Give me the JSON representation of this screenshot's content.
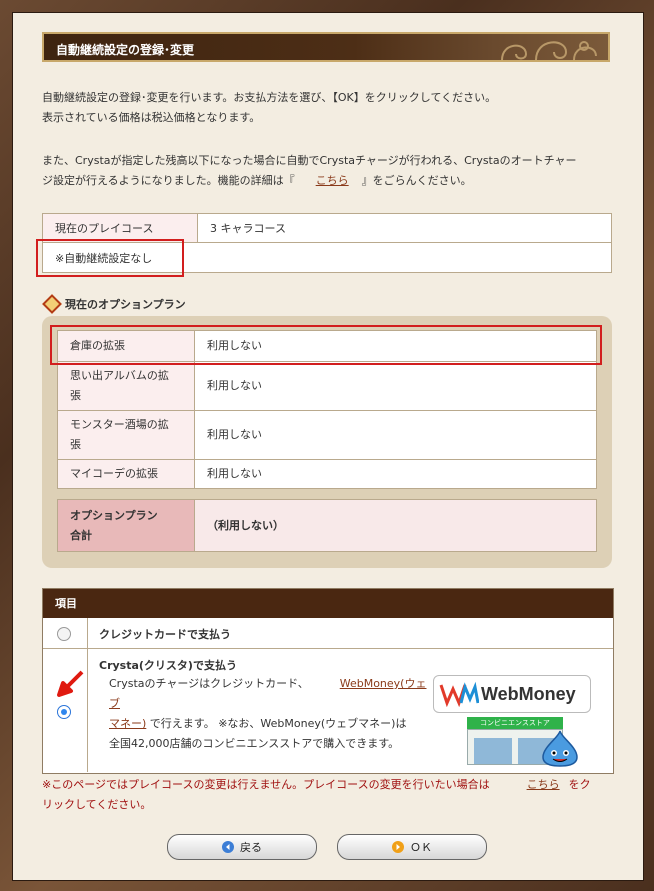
{
  "page": {
    "title": "自動継続設定の登録･変更",
    "intro_lines": [
      "自動継続設定の登録･変更を行います。お支払方法を選び、【OK】をクリックしてください。",
      "表示されている価格は税込価格となります。"
    ],
    "notice_line1": "また、Crystaが指定した残高以下になった場合に自動でCrystaチャージが行われる、Crystaのオートチャー",
    "notice_line2_prefix": "ジ設定が行えるようになりました。機能の詳細は『",
    "notice_link": "こちら",
    "notice_line2_suffix": "』をごらんください。"
  },
  "current": {
    "play_course_label": "現在のプレイコース",
    "play_course_value": "3 キャラコース",
    "auto_renew_note": "※自動継続設定なし"
  },
  "options": {
    "heading": "現在のオプションプラン",
    "rows": [
      {
        "label": "倉庫の拡張",
        "value": "利用しない"
      },
      {
        "label_l1": "思い出アルバムの拡",
        "label_l2": "張",
        "value": "利用しない"
      },
      {
        "label_l1": "モンスター酒場の拡",
        "label_l2": "張",
        "value": "利用しない"
      },
      {
        "label": "マイコーデの拡張",
        "value": "利用しない"
      }
    ],
    "total_label_l1": "オプションプラン",
    "total_label_l2": "合計",
    "total_value": "（利用しない）"
  },
  "payment": {
    "header": "項目",
    "credit_label": "クレジットカードで支払う",
    "crysta_label": "Crysta(クリスタ)で支払う",
    "crysta_desc_1a": "Crystaのチャージはクレジットカード、",
    "crysta_desc_1b": "WebMoney(ウェブ",
    "crysta_desc_2a": "マネー)",
    "crysta_desc_2b": "で行えます。 ※なお、WebMoney(ウェブマネー)は",
    "crysta_desc_3": "全国42,000店舗のコンビニエンスストアで購入できます。",
    "webmoney_brand": "WebMoney",
    "webmoney_store": "コンビニエンスストア",
    "selected": "crysta"
  },
  "warning": {
    "prefix": "※このページではプレイコースの変更は行えません。プレイコースの変更を行いたい場合は",
    "link": "こちら",
    "suffix": "をク",
    "line2": "リックしてください。"
  },
  "buttons": {
    "back_label": "戻る",
    "ok_label": "ＯＫ"
  },
  "colors": {
    "title_bg": "#4d2e16",
    "header_bg": "#4a2711",
    "highlight_red": "#d21e1e",
    "warning_text": "#a01010"
  }
}
